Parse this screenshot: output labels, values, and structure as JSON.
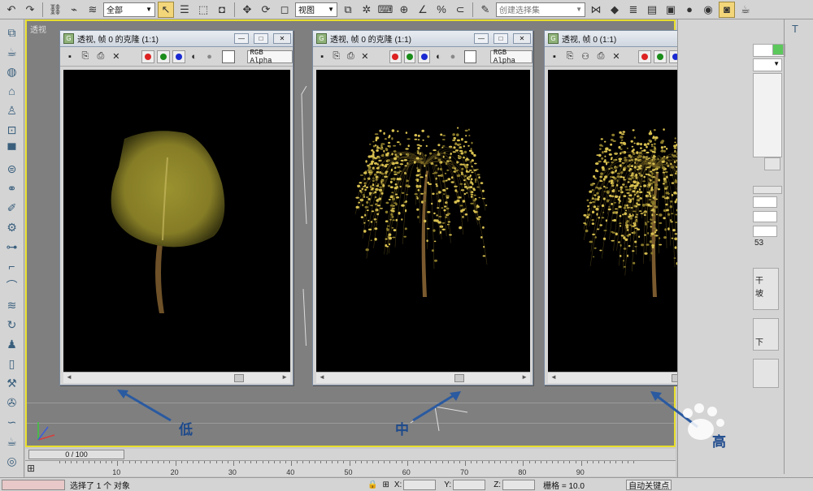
{
  "toolbar": {
    "select_filter": "全部",
    "ref_coord": "视图",
    "named_selection_placeholder": "创建选择集"
  },
  "viewport": {
    "label": "透视"
  },
  "render_windows": [
    {
      "title": "透视, 帧 0 的克隆 (1:1)",
      "channel": "RGB Alpha",
      "tree_type": "low-detail",
      "annotation": "低"
    },
    {
      "title": "透视, 帧 0 的克隆 (1:1)",
      "channel": "RGB Alpha",
      "tree_type": "medium-detail",
      "annotation": "中"
    },
    {
      "title": "透视, 帧 0 (1:1)",
      "channel": "",
      "tree_type": "high-detail",
      "annotation": "高"
    }
  ],
  "timeline": {
    "frame_display": "0 / 100",
    "ticks": [
      "10",
      "20",
      "30",
      "40",
      "50",
      "60",
      "70",
      "80",
      "90"
    ]
  },
  "status": {
    "selection_text": "选择了 1 个 对象",
    "x_label": "X:",
    "y_label": "Y:",
    "z_label": "Z:",
    "grid_text": "栅格 = 10.0",
    "autokey_label": "自动关键点"
  },
  "right_panel": {
    "snippet_1": "干",
    "snippet_2": "坡",
    "snippet_3": "53",
    "snippet_4": "下"
  },
  "colors": {
    "viewport_border": "#e8df2c",
    "leaf_low": "#8c8428",
    "leaf_detail": "#d8c050",
    "trunk": "#7a5a2e",
    "annotation_blue": "#1e4a8c"
  }
}
